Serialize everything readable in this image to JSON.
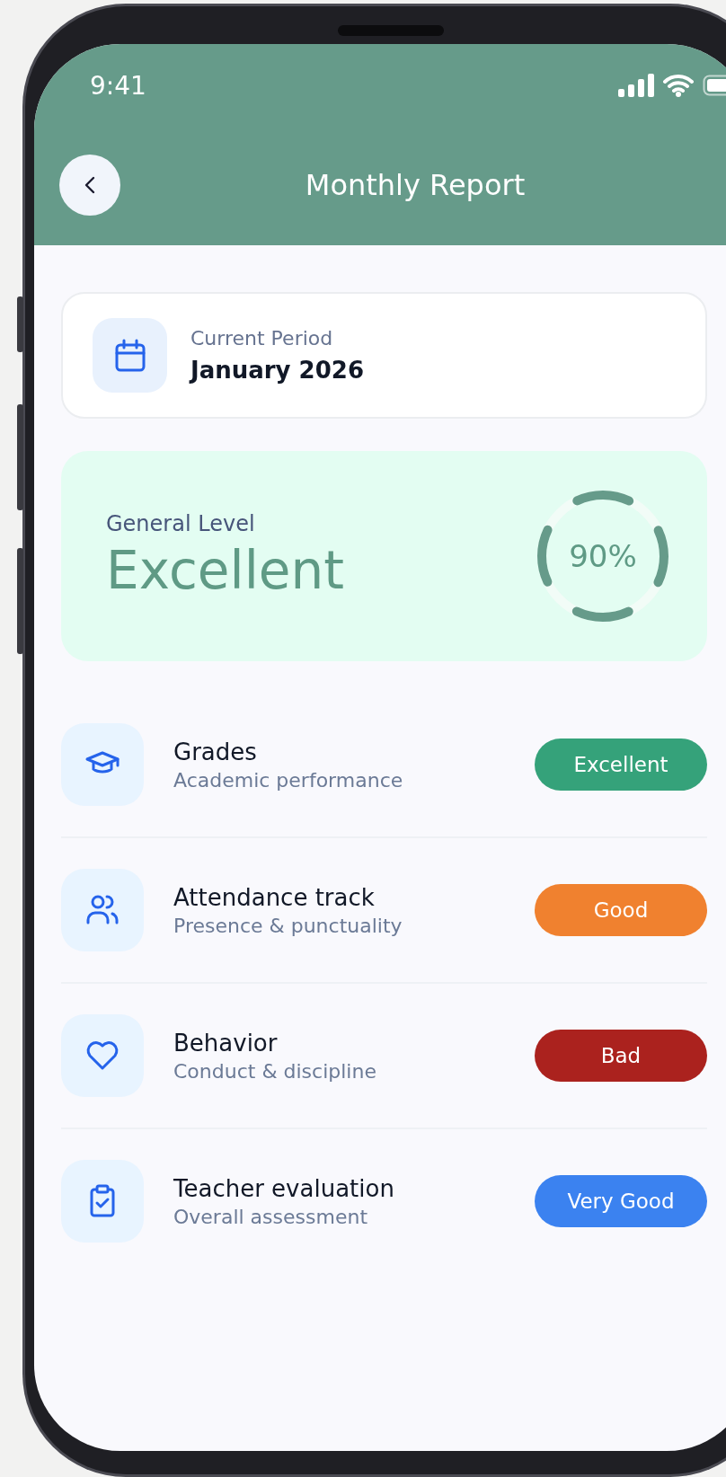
{
  "status_bar": {
    "time": "9:41"
  },
  "header": {
    "title": "Monthly Report"
  },
  "period": {
    "label": "Current Period",
    "value": "January 2026"
  },
  "general_level": {
    "label": "General Level",
    "rating": "Excellent",
    "percent": "90%"
  },
  "categories": [
    {
      "title": "Grades",
      "subtitle": "Academic performance",
      "status": "Excellent",
      "color": "#35a27a"
    },
    {
      "title": "Attendance track",
      "subtitle": "Presence & punctuality",
      "status": "Good",
      "color": "#f0812f"
    },
    {
      "title": "Behavior",
      "subtitle": "Conduct & discipline",
      "status": "Bad",
      "color": "#ab221e"
    },
    {
      "title": "Teacher evaluation",
      "subtitle": "Overall assessment",
      "status": "Very Good",
      "color": "#3b82f0"
    }
  ]
}
